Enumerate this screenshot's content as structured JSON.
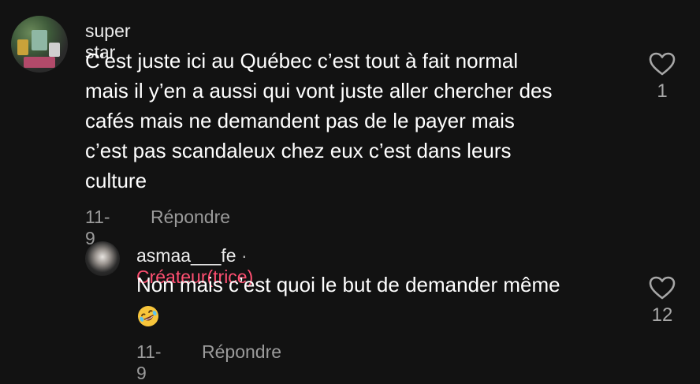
{
  "comments": [
    {
      "username": "super star",
      "text": "C’est juste ici au Québec c’est tout à fait normal mais il y’en a aussi qui vont juste aller chercher des cafés mais ne demandent pas de le payer mais c’est pas scandaleux chez eux c’est dans leurs culture",
      "lines": [
        "C’est juste ici au Québec c’est tout à fait normal",
        "mais il y’en a aussi qui vont juste aller chercher des",
        "cafés mais ne demandent pas de le payer mais",
        "c’est pas scandaleux chez eux c’est dans leurs",
        "culture"
      ],
      "date": "11-9",
      "reply_label": "Répondre",
      "likes": "1",
      "icon": "heart-outline-icon"
    },
    {
      "username": "asmaa___fe",
      "separator": "·",
      "badge": "Créateur(trice)",
      "text": "Non mais c’est quoi le but de demander même",
      "emoji": "rolling-on-floor-laughing-emoji",
      "date": "11-9",
      "reply_label": "Répondre",
      "likes": "12",
      "icon": "heart-outline-icon"
    }
  ],
  "colors": {
    "background": "#121212",
    "creator_badge": "#ff4f71",
    "meta_text": "#9b9b9b"
  }
}
